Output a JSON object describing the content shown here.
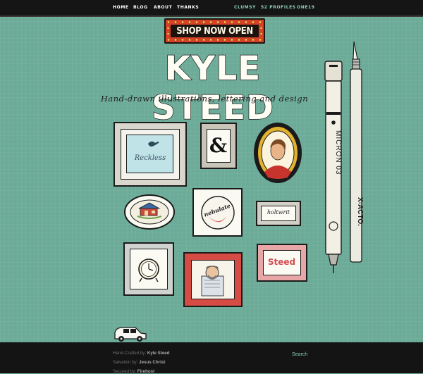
{
  "nav": {
    "items": [
      {
        "label": "HOME"
      },
      {
        "label": "BLOG"
      },
      {
        "label": "ABOUT"
      },
      {
        "label": "THANKS"
      }
    ],
    "alt_items": [
      {
        "label": "CLUMSY"
      },
      {
        "label": "52 PROFILES"
      },
      {
        "label": "ONE19"
      }
    ]
  },
  "sign": {
    "label": "SHOP NOW OPEN"
  },
  "header": {
    "title": "KYLE STEED",
    "subtitle": "Hand-drawn illustrations, lettering and design"
  },
  "gallery": {
    "reckless_label": "Reckless",
    "ampersand": "&",
    "holdwrit_label": "holtwrit",
    "nebulate_label": "nebulate",
    "steed_label": "Steed"
  },
  "tools": {
    "pen_brand": "MICRON 03",
    "knife_brand": "X-ACTO."
  },
  "footer": {
    "line1_prefix": "Hand-Crafted by:",
    "line1_value": "Kyle Steed",
    "line2_prefix": "Salvation by:",
    "line2_value": "Jesus Christ",
    "line3_prefix": "Secured by:",
    "line3_value": "Firehost",
    "search_label": "Search"
  },
  "colors": {
    "background": "#6cab98",
    "nav_bar": "#151515",
    "sign_red": "#d8402a",
    "accent_pink": "#e06b70"
  }
}
